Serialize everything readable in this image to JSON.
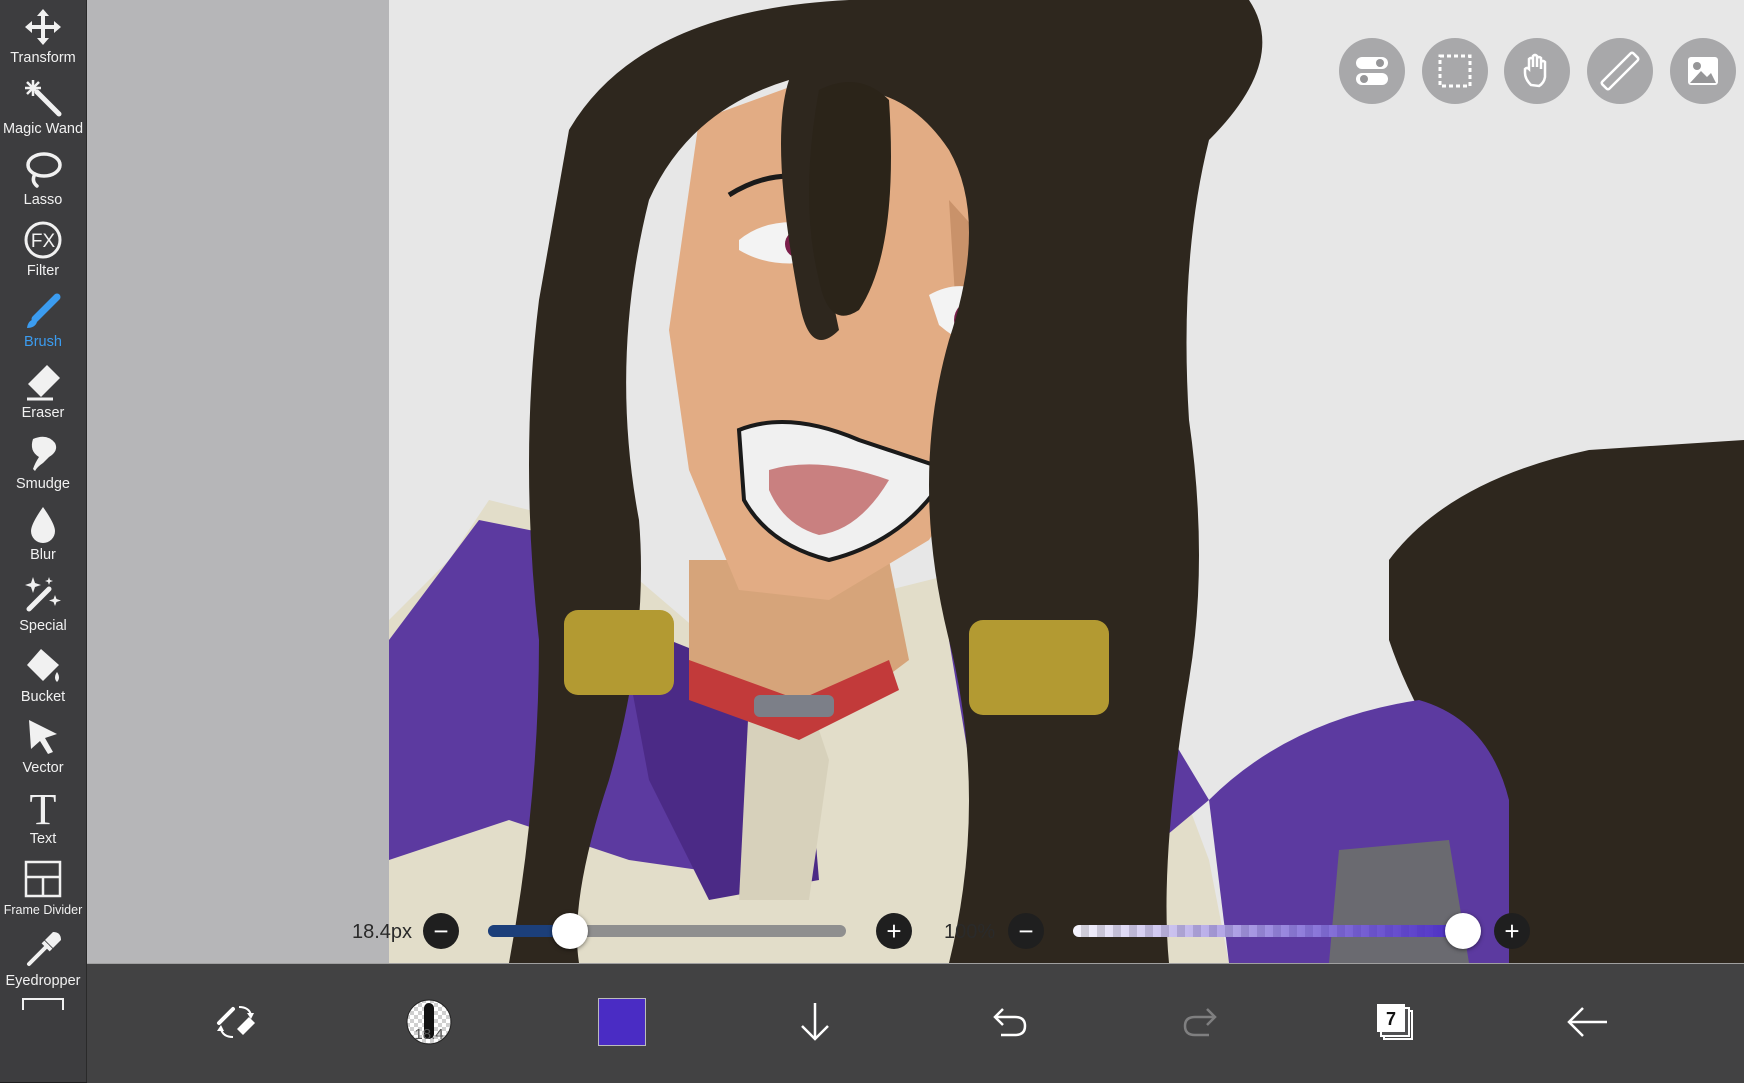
{
  "toolbar": {
    "items": [
      {
        "label": "Transform",
        "icon": "move-arrows-icon"
      },
      {
        "label": "Magic Wand",
        "icon": "magic-wand-icon"
      },
      {
        "label": "Lasso",
        "icon": "lasso-icon"
      },
      {
        "label": "Filter",
        "icon": "fx-icon"
      },
      {
        "label": "Brush",
        "icon": "brush-icon",
        "active": true
      },
      {
        "label": "Eraser",
        "icon": "eraser-icon"
      },
      {
        "label": "Smudge",
        "icon": "smudge-icon"
      },
      {
        "label": "Blur",
        "icon": "droplet-icon"
      },
      {
        "label": "Special",
        "icon": "sparkle-pen-icon"
      },
      {
        "label": "Bucket",
        "icon": "bucket-icon"
      },
      {
        "label": "Vector",
        "icon": "cursor-arrow-icon"
      },
      {
        "label": "Text",
        "icon": "text-t-icon"
      },
      {
        "label": "Frame Divider",
        "icon": "frame-divider-icon"
      },
      {
        "label": "Eyedropper",
        "icon": "eyedropper-icon"
      }
    ],
    "active_color": "#3b9cf0"
  },
  "fx_glyph": "FX",
  "text_glyph": "T",
  "top_buttons": [
    "toggle-icon",
    "selection-icon",
    "hand-icon",
    "ruler-icon",
    "image-icon"
  ],
  "brush_size": {
    "label": "18.4px",
    "fraction": 0.23
  },
  "opacity": {
    "label": "100%",
    "fraction": 1.0
  },
  "minus_glyph": "−",
  "plus_glyph": "+",
  "bottom_bar": {
    "brush_preview_value": "18.4",
    "current_color": "#4a2cc4",
    "layer_count": "7",
    "buttons": [
      "swap-tools-icon",
      "brush-preview-icon",
      "color-swatch",
      "download-arrow-icon",
      "undo-icon",
      "redo-icon",
      "layers-icon",
      "back-arrow-icon"
    ]
  }
}
